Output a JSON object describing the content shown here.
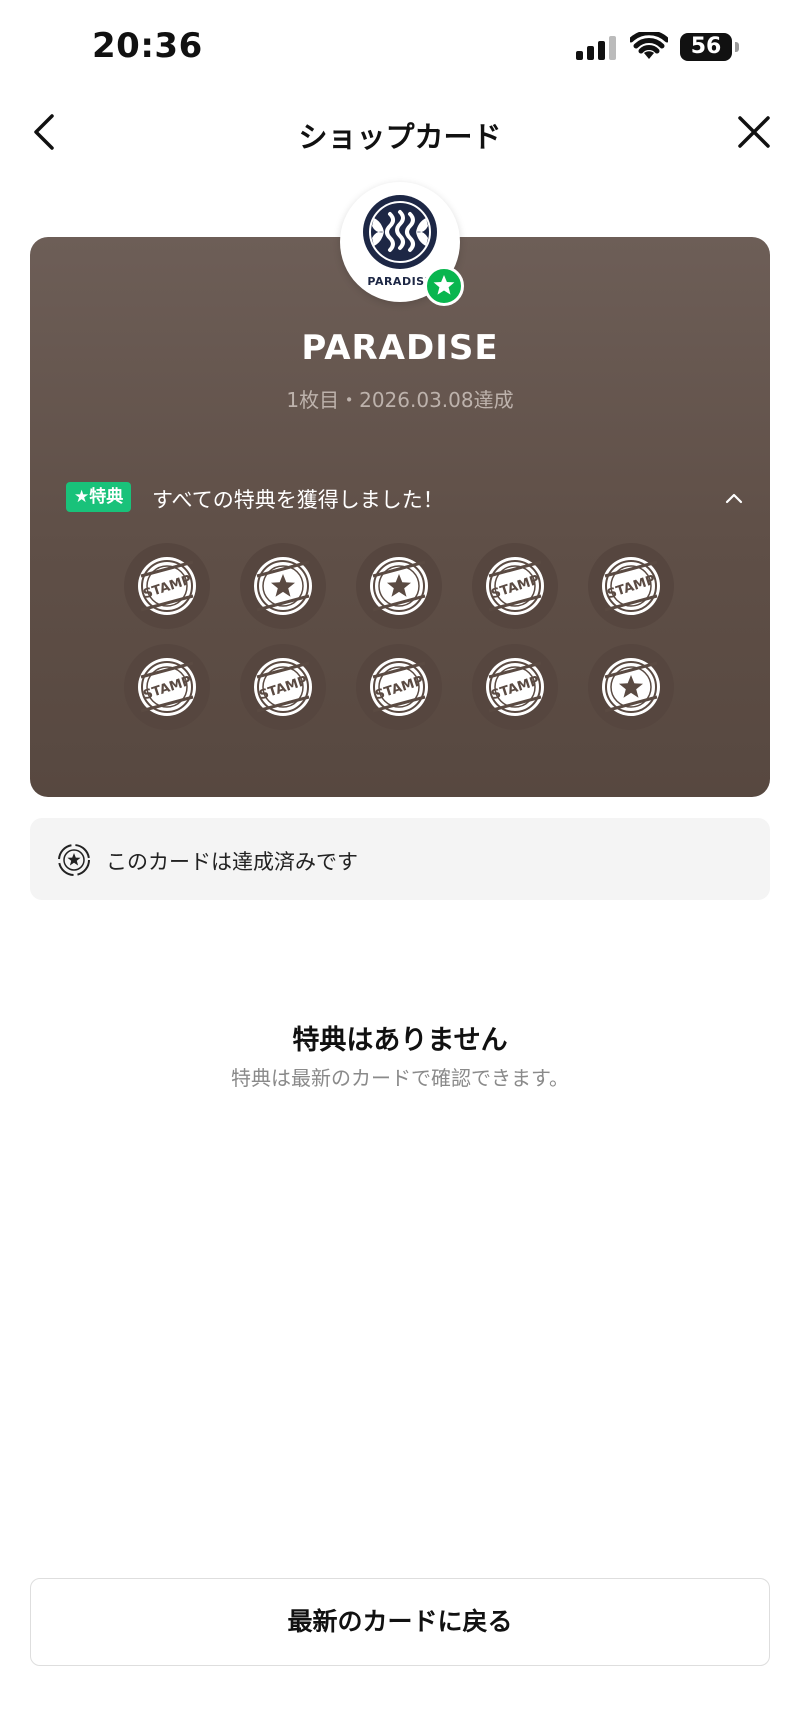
{
  "status_bar": {
    "time": "20:36",
    "battery": "56"
  },
  "nav": {
    "title": "ショップカード"
  },
  "card": {
    "shop_name": "PARADISE",
    "subtitle": "1枚目・2026.03.08達成",
    "logo_text": "PARADISE",
    "benefit_tag": "★特典",
    "benefit_text": "すべての特典を獲得しました！",
    "colors": {
      "card_top": "#6d5e57",
      "card_bottom": "#574840",
      "tag": "#19c27a",
      "badge": "#09b64f"
    },
    "stamps": [
      {
        "type": "stamp-text"
      },
      {
        "type": "star"
      },
      {
        "type": "star"
      },
      {
        "type": "stamp-text"
      },
      {
        "type": "stamp-text"
      },
      {
        "type": "stamp-text"
      },
      {
        "type": "stamp-text"
      },
      {
        "type": "stamp-text"
      },
      {
        "type": "stamp-text"
      },
      {
        "type": "star"
      }
    ],
    "stamp_label": "STAMP"
  },
  "notice": {
    "text": "このカードは達成済みです"
  },
  "empty": {
    "title": "特典はありません",
    "subtitle": "特典は最新のカードで確認できます。"
  },
  "bottom_button": {
    "label": "最新のカードに戻る"
  }
}
